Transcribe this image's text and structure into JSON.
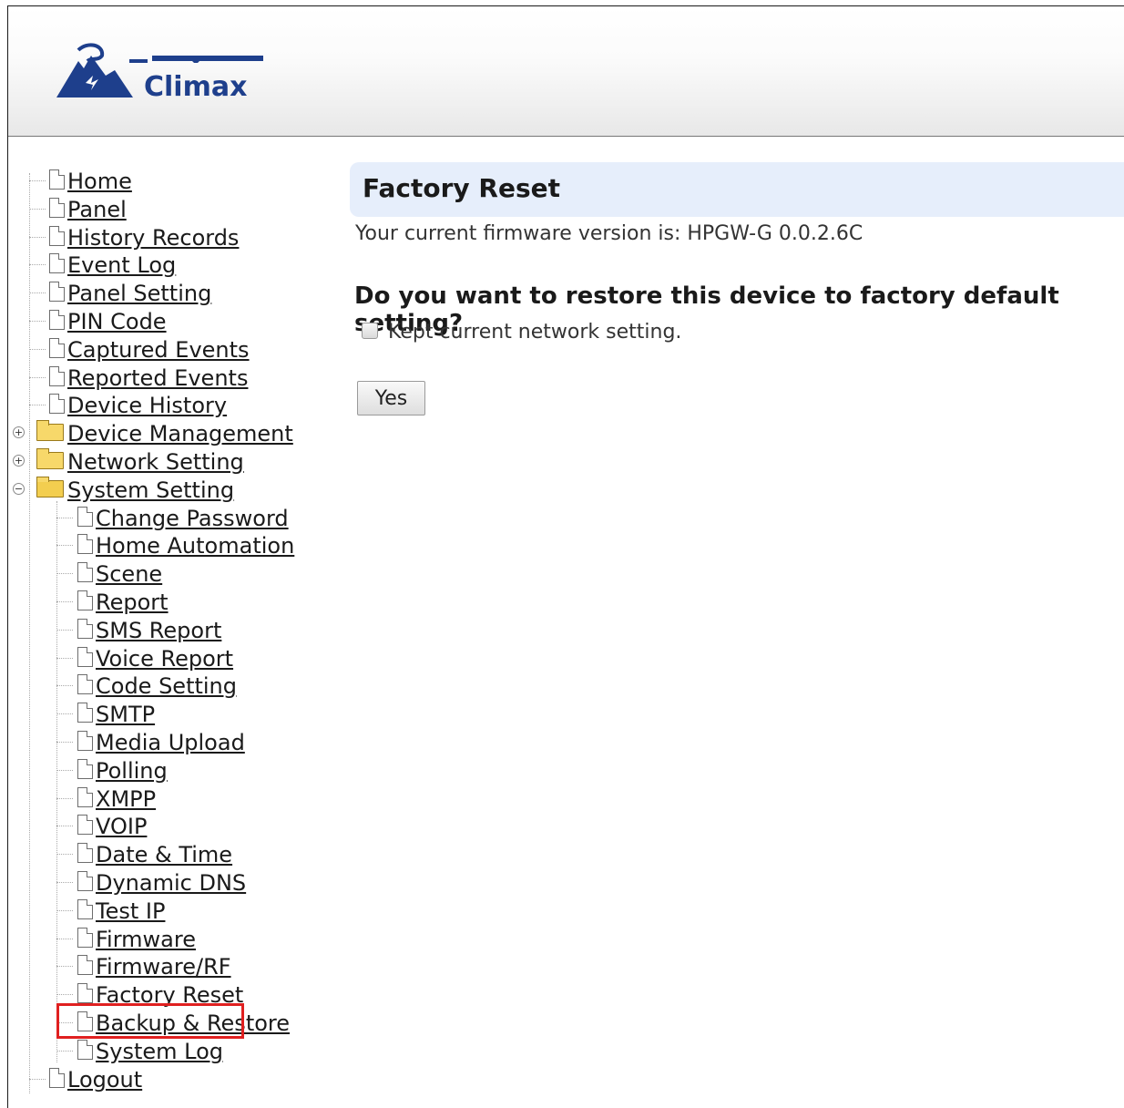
{
  "brand": {
    "logo_text": "Climax"
  },
  "nav": {
    "top_items": [
      {
        "label": "Home"
      },
      {
        "label": "Panel"
      },
      {
        "label": "History Records"
      },
      {
        "label": "Event Log"
      },
      {
        "label": "Panel Setting"
      },
      {
        "label": "PIN Code"
      },
      {
        "label": "Captured Events"
      },
      {
        "label": "Reported Events"
      },
      {
        "label": "Device History"
      }
    ],
    "folders": [
      {
        "label": "Device Management",
        "expanded": false
      },
      {
        "label": "Network Setting",
        "expanded": false
      },
      {
        "label": "System Setting",
        "expanded": true
      }
    ],
    "system_items": [
      {
        "label": "Change Password"
      },
      {
        "label": "Home Automation"
      },
      {
        "label": "Scene"
      },
      {
        "label": "Report"
      },
      {
        "label": "SMS Report"
      },
      {
        "label": "Voice Report"
      },
      {
        "label": "Code Setting"
      },
      {
        "label": "SMTP"
      },
      {
        "label": "Media Upload"
      },
      {
        "label": "Polling"
      },
      {
        "label": "XMPP"
      },
      {
        "label": "VOIP"
      },
      {
        "label": "Date & Time"
      },
      {
        "label": "Dynamic DNS"
      },
      {
        "label": "Test IP"
      },
      {
        "label": "Firmware"
      },
      {
        "label": "Firmware/RF"
      },
      {
        "label": "Factory Reset"
      },
      {
        "label": "Backup & Restore"
      },
      {
        "label": "System Log"
      }
    ],
    "logout": {
      "label": "Logout"
    },
    "highlighted_item": "Backup & Restore"
  },
  "main": {
    "title": "Factory Reset",
    "firmware_text": "Your current firmware version is: HPGW-G 0.0.2.6C",
    "question": "Do you want to restore this device to factory default setting?",
    "checkbox_label": "Kept current network setting.",
    "checkbox_checked": false,
    "yes_label": "Yes"
  },
  "colors": {
    "brand": "#1e3f8c",
    "title_bar": "#e6eefb",
    "highlight": "#e02020"
  }
}
